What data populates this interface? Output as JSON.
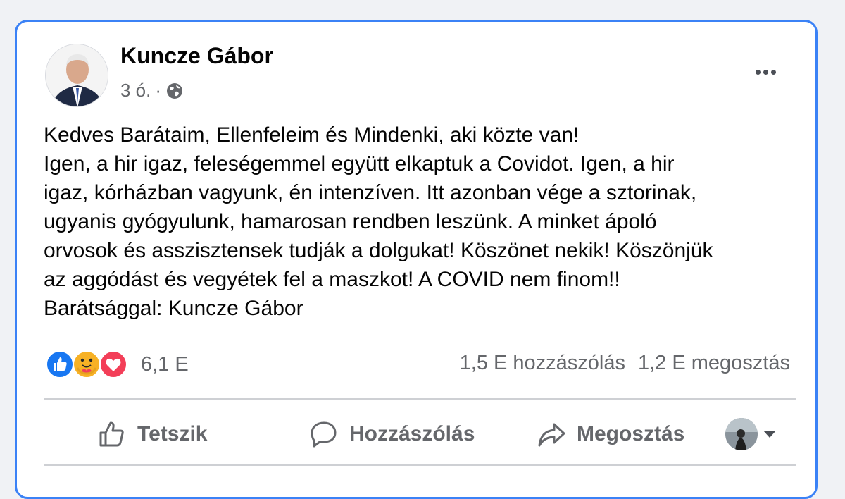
{
  "post": {
    "author": "Kuncze Gábor",
    "time": "3 ó.",
    "separator": "·",
    "privacy_icon": "globe-icon",
    "more_icon": "more-options-icon",
    "text_lines": [
      "Kedves Barátaim, Ellenfeleim és Mindenki, aki közte van!",
      "Igen, a hir igaz, feleségemmel együtt elkaptuk a Covidot. Igen, a hir",
      "igaz, kórházban vagyunk, én intenzíven. Itt azonban vége a sztorinak,",
      "ugyanis gyógyulunk, hamarosan rendben leszünk. A minket ápoló",
      "orvosok és asszisztensek tudják a dolgukat! Köszönet nekik! Köszönjük",
      "az aggódást és vegyétek fel a maszkot! A COVID nem finom!!",
      "Barátsággal: Kuncze Gábor"
    ]
  },
  "reactions": {
    "icons": [
      "like-reaction-icon",
      "care-reaction-icon",
      "love-reaction-icon"
    ],
    "count": "6,1 E",
    "comments": "1,5 E hozzászólás",
    "shares": "1,2 E megosztás"
  },
  "actions": {
    "like": "Tetszik",
    "comment": "Hozzászólás",
    "share": "Megosztás"
  },
  "colors": {
    "card_border": "#3b82f6",
    "secondary_text": "#65676b",
    "like_blue": "#1877f2",
    "love_red": "#f33e58",
    "care_yellow": "#f7b125"
  }
}
